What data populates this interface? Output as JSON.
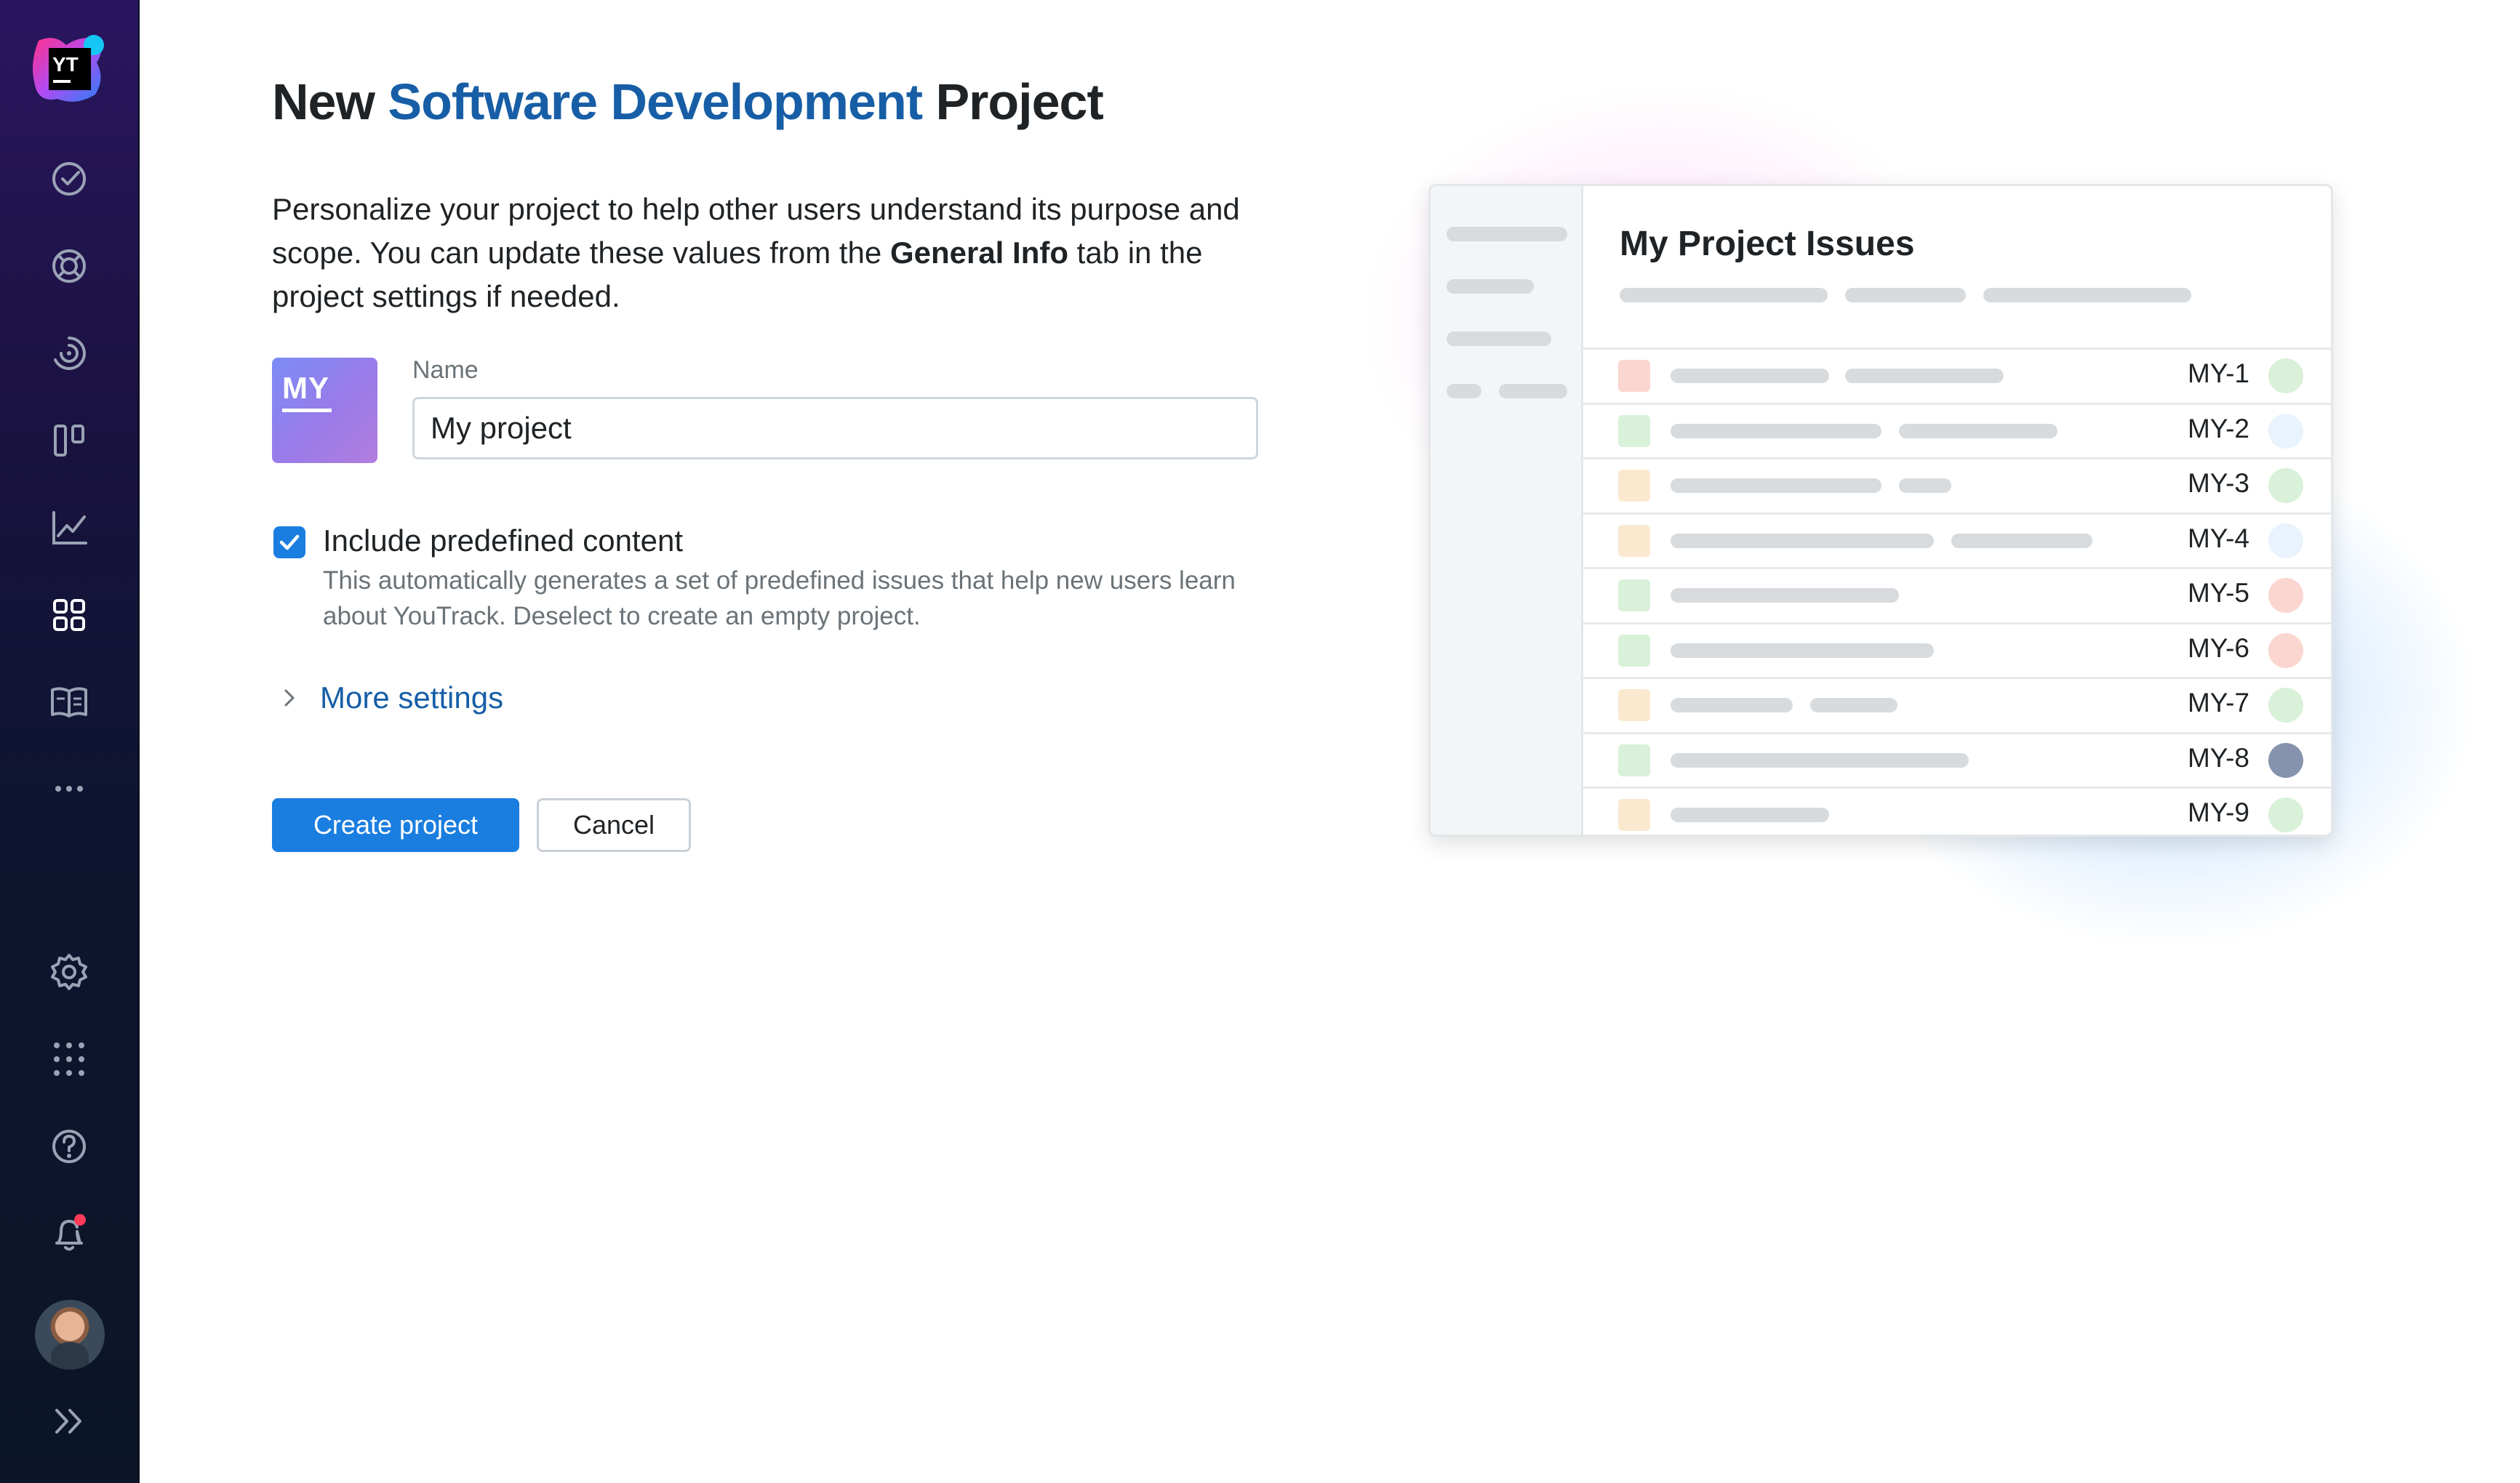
{
  "sidebar": {
    "logo_text": "YT",
    "nav": [
      {
        "name": "issues-icon",
        "label": "Issues"
      },
      {
        "name": "helpdesk-icon",
        "label": "Helpdesk"
      },
      {
        "name": "time-tracking-icon",
        "label": "Time"
      },
      {
        "name": "agile-boards-icon",
        "label": "Agile Boards"
      },
      {
        "name": "reports-icon",
        "label": "Reports"
      },
      {
        "name": "projects-icon",
        "label": "Projects"
      },
      {
        "name": "knowledge-base-icon",
        "label": "Knowledge Base"
      },
      {
        "name": "more-icon",
        "label": "More"
      }
    ],
    "bottom": [
      {
        "name": "settings-icon"
      },
      {
        "name": "apps-grid-icon"
      },
      {
        "name": "help-icon"
      },
      {
        "name": "notifications-bell-icon"
      }
    ],
    "notification_dot_color": "#ff3b58"
  },
  "page": {
    "title_prefix": "New ",
    "title_accent": "Software Development",
    "title_suffix": " Project",
    "description_part1": "Personalize your project to help other users understand its purpose and scope. You can update these values from the ",
    "description_bold": "General Info",
    "description_part2": " tab in the project settings if needed."
  },
  "project_icon": {
    "text": "MY"
  },
  "name_field": {
    "label": "Name",
    "value": "My project"
  },
  "predefined": {
    "checked": true,
    "label": "Include predefined content",
    "help": "This automatically generates a set of predefined issues that help new users learn about YouTrack. Deselect to create an empty project."
  },
  "more_settings": {
    "label": "More settings"
  },
  "buttons": {
    "create": "Create project",
    "cancel": "Cancel"
  },
  "preview": {
    "title": "My Project Issues",
    "issues": [
      {
        "id": "MY-1",
        "square_color": "#fbd5cf",
        "dot_color": "#d9f0d9"
      },
      {
        "id": "MY-2",
        "square_color": "#d9f0d9",
        "dot_color": "#e8f3fd"
      },
      {
        "id": "MY-3",
        "square_color": "#fbe9cf",
        "dot_color": "#d9f0d9"
      },
      {
        "id": "MY-4",
        "square_color": "#fbe9cf",
        "dot_color": "#e8f3fd"
      },
      {
        "id": "MY-5",
        "square_color": "#d9f0d9",
        "dot_color": "#fbd5cf"
      },
      {
        "id": "MY-6",
        "square_color": "#d9f0d9",
        "dot_color": "#fbd5cf"
      },
      {
        "id": "MY-7",
        "square_color": "#fbe9cf",
        "dot_color": "#d9f0d9"
      },
      {
        "id": "MY-8",
        "square_color": "#d9f0d9",
        "dot_color": "#8593ad"
      },
      {
        "id": "MY-9",
        "square_color": "#fbe9cf",
        "dot_color": "#d9f0d9"
      }
    ]
  },
  "colors": {
    "accent": "#175ea6",
    "primary_button": "#1a7ee0"
  }
}
